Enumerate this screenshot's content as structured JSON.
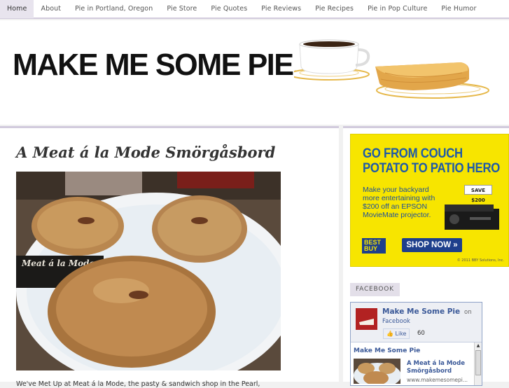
{
  "nav": {
    "items": [
      {
        "label": "Home",
        "active": true
      },
      {
        "label": "About"
      },
      {
        "label": "Pie in Portland, Oregon"
      },
      {
        "label": "Pie Store"
      },
      {
        "label": "Pie Quotes"
      },
      {
        "label": "Pie Reviews"
      },
      {
        "label": "Pie Recipes"
      },
      {
        "label": "Pie in Pop Culture"
      },
      {
        "label": "Pie Humor"
      }
    ]
  },
  "header": {
    "site_title": "MAKE ME SOME PIE."
  },
  "post": {
    "title": "A Meat á la Mode Smörgåsbord",
    "photo_sign": "Meat á la Mode",
    "body_start": "We've Met Up at Meat á la Mode, the pasty & sandwich shop in the Pearl,"
  },
  "ad": {
    "headline_1": "GO FROM COUCH",
    "headline_2": "POTATO TO PATIO HERO",
    "body_1": "Make your backyard",
    "body_2": "more entertaining with",
    "body_3": "$200 off an EPSON",
    "body_4": "MovieMate projector.",
    "save_label": "SAVE $200",
    "brand": "BEST BUY",
    "cta": "SHOP NOW »",
    "legal": "© 2011 BBY Solutions, Inc."
  },
  "facebook": {
    "section_title": "FACEBOOK",
    "page_name": "Make Me Some Pie",
    "on_text": "on",
    "platform": "Facebook",
    "like_label": "Like",
    "like_count": "60",
    "feed_name": "Make Me Some Pie",
    "post_title_1": "A Meat á la Mode",
    "post_title_2": "Smörgåsbord",
    "post_url": "www.makemesomepi..."
  },
  "colors": {
    "accent_border": "#d2cbdd",
    "nav_active_bg": "#e8e4ee",
    "ad_yellow": "#f7e500",
    "ad_blue": "#1e5aa8",
    "facebook_blue": "#3b5998"
  }
}
